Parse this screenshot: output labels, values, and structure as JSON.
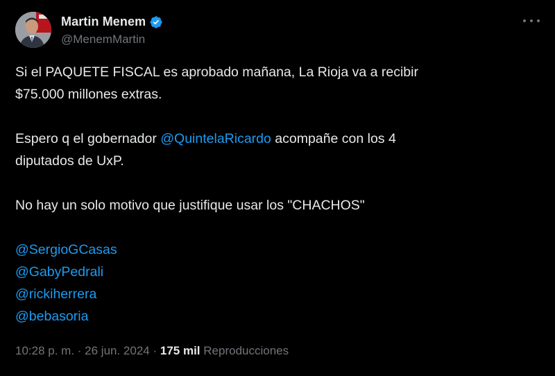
{
  "author": {
    "display_name": "Martin Menem",
    "handle": "@MenemMartin",
    "verified_color": "#1d9bf0",
    "avatar_icon": "profile-photo"
  },
  "menu": {
    "icon": "more-options-icon"
  },
  "tweet": {
    "line1": "Si el PAQUETE FISCAL es aprobado mañana, La Rioja va a recibir",
    "line2": "$75.000 millones extras.",
    "line3_prefix": "Espero q el gobernador ",
    "line3_mention": "@QuintelaRicardo",
    "line3_suffix": " acompañe con los 4",
    "line4": "diputados de UxP.",
    "line5": "No hay un solo motivo que justifique usar los \"CHACHOS\"",
    "mentions": [
      "@SergioGCasas",
      "@GabyPedrali",
      "@rickiherrera",
      "@bebasoria"
    ]
  },
  "meta": {
    "time": "10:28 p. m.",
    "separator": " · ",
    "date": "26 jun. 2024",
    "views_count": "175 mil",
    "views_label": "Reproducciones"
  },
  "colors": {
    "background": "#000000",
    "text": "#e7e9ea",
    "secondary": "#71767b",
    "link": "#1d9bf0"
  }
}
